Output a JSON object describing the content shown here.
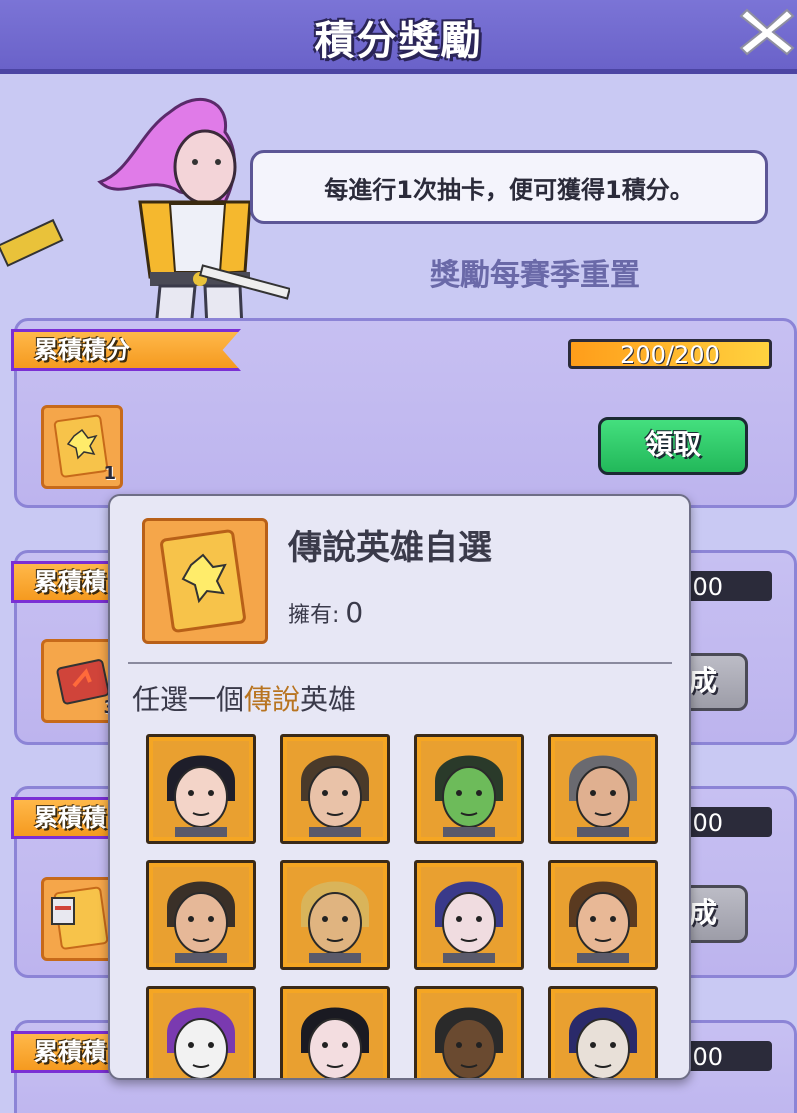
{
  "header": {
    "title": "積分獎勵"
  },
  "info": {
    "bubble_text": "每進行1次抽卡，便可獲得1積分。",
    "reset_note": "獎勵每賽季重置"
  },
  "cards": [
    {
      "banner": "累積積分",
      "progress_text": "200/200",
      "progress_fraction": 1.0,
      "item_count": "1",
      "button_label": "領取"
    },
    {
      "banner": "累積積",
      "progress_text": "00",
      "item_count": "3",
      "button_label": "成"
    },
    {
      "banner": "累積積",
      "progress_text": "00",
      "button_label": "成"
    },
    {
      "banner": "累積積",
      "progress_text": "00"
    }
  ],
  "popup": {
    "title": "傳說英雄自選",
    "owned_label": "擁有:",
    "owned_value": "0",
    "choose_prefix": "任選一個",
    "choose_accent": "傳說",
    "choose_suffix": "英雄",
    "heroes": [
      {
        "icon": "hero-portrait-dark-hair-woman"
      },
      {
        "icon": "hero-portrait-slick-hair-man"
      },
      {
        "icon": "hero-portrait-green-zombie"
      },
      {
        "icon": "hero-portrait-bearded-soldier"
      },
      {
        "icon": "hero-portrait-curly-hair-man"
      },
      {
        "icon": "hero-portrait-blonde-bearded-man"
      },
      {
        "icon": "hero-portrait-blue-hair-girl"
      },
      {
        "icon": "hero-portrait-brown-hair-woman"
      },
      {
        "icon": "hero-portrait-clown"
      },
      {
        "icon": "hero-portrait-black-hair-girl"
      },
      {
        "icon": "hero-portrait-dreadlocks-man"
      },
      {
        "icon": "hero-portrait-masked-man"
      }
    ]
  },
  "colors": {
    "accent_orange": "#f5a623",
    "claim_green": "#2ecc71",
    "header_purple": "#6a62c9",
    "legendary_text": "#b87420"
  }
}
